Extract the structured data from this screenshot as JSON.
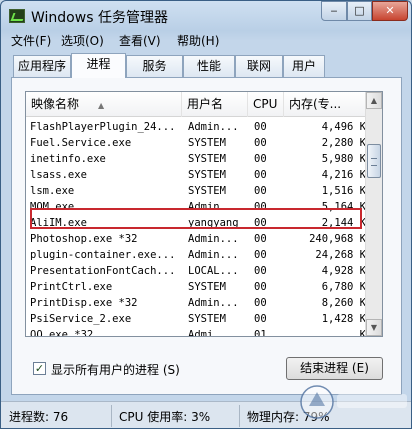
{
  "window": {
    "title": "Windows 任务管理器"
  },
  "caption_buttons": {
    "minimize": "‒",
    "maximize": "□",
    "close": "✕"
  },
  "menu": [
    "文件(F)",
    "选项(O)",
    "查看(V)",
    "帮助(H)"
  ],
  "tabs": [
    "应用程序",
    "进程",
    "服务",
    "性能",
    "联网",
    "用户"
  ],
  "active_tab": "进程",
  "columns": [
    "映像名称",
    "用户名",
    "CPU",
    "内存(专..."
  ],
  "processes": [
    {
      "name": "FlashPlayerPlugin_24...",
      "user": "Admin...",
      "cpu": "00",
      "mem": "4,496 K"
    },
    {
      "name": "Fuel.Service.exe",
      "user": "SYSTEM",
      "cpu": "00",
      "mem": "2,280 K"
    },
    {
      "name": "inetinfo.exe",
      "user": "SYSTEM",
      "cpu": "00",
      "mem": "5,980 K"
    },
    {
      "name": "lsass.exe",
      "user": "SYSTEM",
      "cpu": "00",
      "mem": "4,216 K"
    },
    {
      "name": "lsm.exe",
      "user": "SYSTEM",
      "cpu": "00",
      "mem": "1,516 K"
    },
    {
      "name": "MOM.exe",
      "user": "Admin...",
      "cpu": "00",
      "mem": "5,164 K"
    },
    {
      "name": "AliIM.exe",
      "user": "yangyang",
      "cpu": "00",
      "mem": "2,144 K"
    },
    {
      "name": "Photoshop.exe *32",
      "user": "Admin...",
      "cpu": "00",
      "mem": "240,968 K"
    },
    {
      "name": "plugin-container.exe...",
      "user": "Admin...",
      "cpu": "00",
      "mem": "24,268 K"
    },
    {
      "name": "PresentationFontCach...",
      "user": "LOCAL...",
      "cpu": "00",
      "mem": "4,928 K"
    },
    {
      "name": "PrintCtrl.exe",
      "user": "SYSTEM",
      "cpu": "00",
      "mem": "6,780 K"
    },
    {
      "name": "PrintDisp.exe *32",
      "user": "Admin...",
      "cpu": "00",
      "mem": "8,260 K"
    },
    {
      "name": "PsiService_2.exe",
      "user": "SYSTEM",
      "cpu": "00",
      "mem": "1,428 K"
    },
    {
      "name": "QQ.exe *32",
      "user": "Admi...",
      "cpu": "01",
      "mem": "... K"
    }
  ],
  "highlighted_process": "AliIM.exe",
  "show_all_users": {
    "label": "显示所有用户的进程 (S)",
    "checked": true
  },
  "end_process_button": "结束进程 (E)",
  "statusbar": {
    "processes": "进程数: 76",
    "cpu": "CPU 使用率: 3%",
    "memory": "物理内存: 79%"
  },
  "colors": {
    "highlight_box": "#c8282e",
    "title_bar": "#c7d8ea"
  }
}
